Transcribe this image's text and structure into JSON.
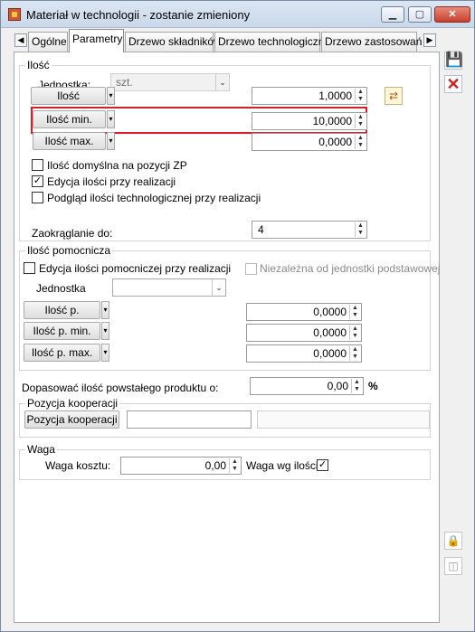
{
  "window": {
    "title": "Materiał w technologii - zostanie zmieniony",
    "controls": {
      "minimize": "▁",
      "maximize": "▢",
      "close": "✕"
    }
  },
  "tabs": [
    {
      "label": "Ogólne"
    },
    {
      "label": "Parametry"
    },
    {
      "label": "Drzewo składników"
    },
    {
      "label": "Drzewo technologiczne"
    },
    {
      "label": "Drzewo zastosowań"
    }
  ],
  "tab_nav": {
    "left": "◀",
    "right": "▶"
  },
  "ilosc_group": {
    "legend": "Ilość",
    "unit_label": "Jednostka:",
    "unit_value": "szt.",
    "quantity_button": "Ilość",
    "quantity_value": "1,0000",
    "min_button": "Ilość min.",
    "min_value": "10,0000",
    "max_button": "Ilość max.",
    "max_value": "0,0000",
    "checks": [
      {
        "label": "Ilość domyślna na pozycji ZP",
        "checked": false
      },
      {
        "label": "Edycja ilości przy realizacji",
        "checked": true
      },
      {
        "label": "Podgląd ilości technologicznej przy realizacji",
        "checked": false
      }
    ],
    "rounding_label": "Zaokrąglanie do:",
    "rounding_value": "4"
  },
  "aux_group": {
    "legend": "Ilość pomocnicza",
    "edit_aux_label": "Edycja ilości pomocniczej przy realizacji",
    "independent_label": "Niezależna od jednostki podstawowej",
    "unit_label": "Jednostka",
    "unit_value": "",
    "aux_button": "Ilość p.",
    "aux_value": "0,0000",
    "aux_min_button": "Ilość p. min.",
    "aux_min_value": "0,0000",
    "aux_max_button": "Ilość p. max.",
    "aux_max_value": "0,0000"
  },
  "product_adjust": {
    "label": "Dopasować ilość powstałego produktu o:",
    "value": "0,00",
    "unit": "%"
  },
  "coop_group": {
    "legend": "Pozycja kooperacji",
    "button": "Pozycja kooperacji",
    "value": "",
    "extra_value": ""
  },
  "weight_group": {
    "legend": "Waga",
    "cost_label": "Waga kosztu:",
    "cost_value": "0,00",
    "qty_label": "Waga wg ilości:",
    "qty_checked": true
  },
  "symbols": {
    "dropdown": "▾",
    "combo_arrow": "⌄",
    "spin_up": "▲",
    "spin_down": "▼",
    "check": "✓",
    "save": "💾",
    "close": "✕",
    "lock": "🔒",
    "small": "◫"
  }
}
